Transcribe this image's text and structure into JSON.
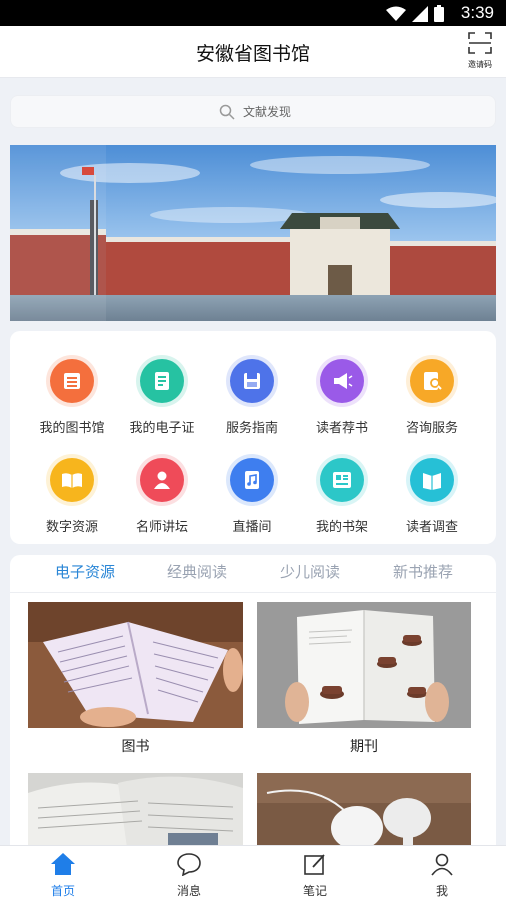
{
  "status_bar": {
    "time": "3:39"
  },
  "header": {
    "title": "安徽省图书馆",
    "scan_label": "邀请码"
  },
  "search": {
    "placeholder": "文献发现"
  },
  "services": [
    {
      "label": "我的图书馆",
      "icon": "library-icon",
      "color": "#f4703e"
    },
    {
      "label": "我的电子证",
      "icon": "e-card-icon",
      "color": "#27c3a3"
    },
    {
      "label": "服务指南",
      "icon": "guide-icon",
      "color": "#4f73ea"
    },
    {
      "label": "读者荐书",
      "icon": "megaphone-icon",
      "color": "#9a5be8"
    },
    {
      "label": "咨询服务",
      "icon": "consult-icon",
      "color": "#f7a928"
    },
    {
      "label": "数字资源",
      "icon": "open-book-icon",
      "color": "#f7b51e"
    },
    {
      "label": "名师讲坛",
      "icon": "lecturer-icon",
      "color": "#ef4b5a"
    },
    {
      "label": "直播间",
      "icon": "music-note-icon",
      "color": "#3f7ef0"
    },
    {
      "label": "我的书架",
      "icon": "bookshelf-icon",
      "color": "#2cc7c9"
    },
    {
      "label": "读者调查",
      "icon": "survey-icon",
      "color": "#27c0d6"
    }
  ],
  "tabs": [
    {
      "label": "电子资源",
      "active": true
    },
    {
      "label": "经典阅读",
      "active": false
    },
    {
      "label": "少儿阅读",
      "active": false
    },
    {
      "label": "新书推荐",
      "active": false
    }
  ],
  "resources": [
    {
      "label": "图书"
    },
    {
      "label": "期刊"
    }
  ],
  "bottom_nav": [
    {
      "label": "首页",
      "icon": "home-icon",
      "active": true
    },
    {
      "label": "消息",
      "icon": "message-icon",
      "active": false
    },
    {
      "label": "笔记",
      "icon": "note-icon",
      "active": false
    },
    {
      "label": "我",
      "icon": "user-icon",
      "active": false
    }
  ],
  "colors": {
    "accent": "#2a86d6",
    "nav_active": "#1f7ee8"
  }
}
